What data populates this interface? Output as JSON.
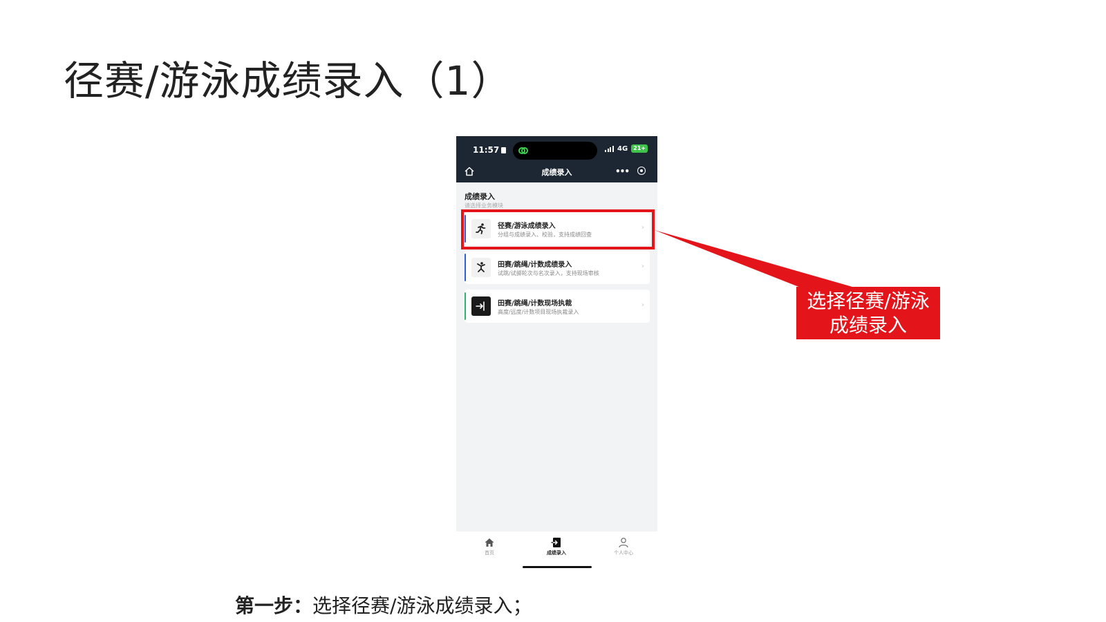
{
  "slide": {
    "title": "径赛/游泳成绩录入（1）",
    "step_label": "第一步：",
    "step_text": "选择径赛/游泳成绩录入；"
  },
  "phone": {
    "status": {
      "time": "11:57",
      "network": "4G",
      "battery": "21+"
    },
    "nav": {
      "title": "成绩录入",
      "more": "•••"
    },
    "section": {
      "title": "成绩录入",
      "subtitle": "请选择业务模块"
    },
    "cards": [
      {
        "title": "径赛/游泳成绩录入",
        "desc": "分组与成绩录入、校验，支持成绩回查",
        "icon": "runner-icon",
        "accent": "#2f5fd0"
      },
      {
        "title": "田赛/跳绳/计数成绩录入",
        "desc": "试跳/试掷轮次与名次录入，支持现场审核",
        "icon": "jumper-icon",
        "accent": "#2f5fd0"
      },
      {
        "title": "田赛/跳绳/计数现场执裁",
        "desc": "高度/远度/计数项目现场执裁录入",
        "icon": "enter-icon",
        "accent": "#2fb36a"
      }
    ],
    "tabs": [
      {
        "label": "首页",
        "icon": "home-icon"
      },
      {
        "label": "成绩录入",
        "icon": "entry-icon"
      },
      {
        "label": "个人中心",
        "icon": "user-icon"
      }
    ]
  },
  "annotation": {
    "callout_text": "选择径赛/游泳成绩录入",
    "color": "#e4141b"
  }
}
